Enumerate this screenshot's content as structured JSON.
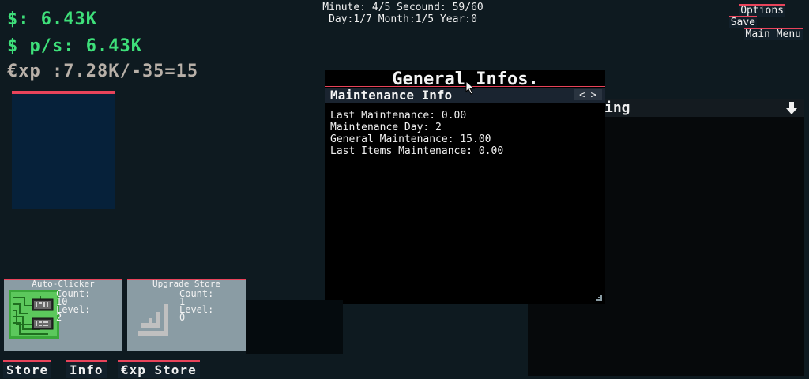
{
  "stats": {
    "money": "$: 6.43K",
    "money_per_sec": "$ p/s: 6.43K",
    "xp": "€xp :7.28K/-35=15"
  },
  "clock": {
    "line1": "Minute: 4/5 Secound: 59/60",
    "line2": "Day:1/7 Month:1/5 Year:0"
  },
  "menu": {
    "options": "Options",
    "save": "Save",
    "main_menu": "Main Menu"
  },
  "cards": [
    {
      "title": "Auto-Clicker",
      "count_label": "Count:",
      "count": "10",
      "level_label": "Level:",
      "level": "2"
    },
    {
      "title": "Upgrade Store",
      "count_label": "Count:",
      "count": "1",
      "level_label": "Level:",
      "level": "0"
    }
  ],
  "bottom_buttons": {
    "store": "Store",
    "info": "Info",
    "xp_store": "€xp Store"
  },
  "background_panel": {
    "title_fragment": "ing"
  },
  "window": {
    "title": "General Infos.",
    "section": "Maintenance Info",
    "nav": "< >",
    "lines": [
      "Last Maintenance: 0.00",
      "Maintenance Day: 2",
      "General Maintenance: 15.00",
      "Last Items Maintenance: 0.00"
    ]
  },
  "colors": {
    "background": "#0e1a20",
    "accent": "#e8435a",
    "money_green": "#3ee07a",
    "panel_blue": "#06213a",
    "card_grey": "#8a9ca4"
  }
}
